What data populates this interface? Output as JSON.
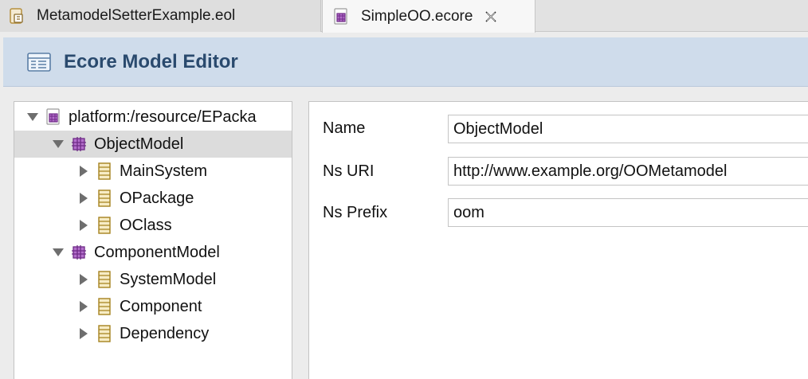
{
  "tabs": [
    {
      "label": "MetamodelSetterExample.eol",
      "icon": "eol-file-icon",
      "active": false
    },
    {
      "label": "SimpleOO.ecore",
      "icon": "ecore-file-icon",
      "active": true,
      "close_icon": "close-icon"
    }
  ],
  "header": {
    "title": "Ecore Model Editor",
    "icon": "editor-icon"
  },
  "tree": {
    "root": {
      "label": "platform:/resource/EPacka",
      "icon": "ecore-resource-icon"
    },
    "packages": [
      {
        "label": "ObjectModel",
        "icon": "epackage-icon",
        "selected": true,
        "children": [
          {
            "label": "MainSystem",
            "icon": "eclass-icon"
          },
          {
            "label": "OPackage",
            "icon": "eclass-icon"
          },
          {
            "label": "OClass",
            "icon": "eclass-icon"
          }
        ]
      },
      {
        "label": "ComponentModel",
        "icon": "epackage-icon",
        "selected": false,
        "children": [
          {
            "label": "SystemModel",
            "icon": "eclass-icon"
          },
          {
            "label": "Component",
            "icon": "eclass-icon"
          },
          {
            "label": "Dependency",
            "icon": "eclass-icon"
          }
        ]
      }
    ]
  },
  "properties": [
    {
      "label": "Name",
      "value": "ObjectModel"
    },
    {
      "label": "Ns URI",
      "value": "http://www.example.org/OOMetamodel"
    },
    {
      "label": "Ns Prefix",
      "value": "oom"
    }
  ],
  "colors": {
    "header_bg": "#cfdceb",
    "header_text": "#2a4a6e",
    "selection": "#dcdcdc",
    "package_icon": "#8e3fa6",
    "class_icon": "#c8a23c"
  }
}
